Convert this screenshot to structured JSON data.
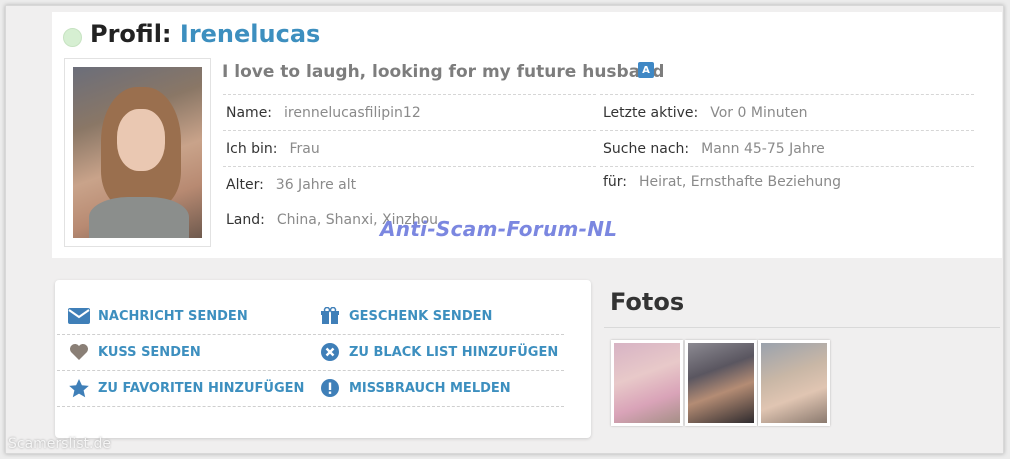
{
  "profile": {
    "title_prefix": "Profil:",
    "username": "Irenelucas",
    "tagline": "I love to laugh, looking for my future husband",
    "left_fields": [
      {
        "label": "Name:",
        "value": "irennelucasfilipin12"
      },
      {
        "label": "Ich bin:",
        "value": "Frau"
      },
      {
        "label": "Alter:",
        "value": "36 Jahre alt"
      },
      {
        "label": "Land:",
        "value": "China, Shanxi, Xinzhou"
      }
    ],
    "right_fields": [
      {
        "label": "Letzte aktive:",
        "value": "Vor 0 Minuten"
      },
      {
        "label": "Suche nach:",
        "value": "Mann 45-75 Jahre"
      },
      {
        "label": "für:",
        "value": "Heirat, Ernsthafte Beziehung"
      }
    ]
  },
  "actions": {
    "send_message": "NACHRICHT SENDEN",
    "send_gift": "GESCHENK SENDEN",
    "send_kiss": "KUSS SENDEN",
    "add_blacklist": "ZU BLACK LIST HINZUFÜGEN",
    "add_favorites": "ZU FAVORITEN HINZUFÜGEN",
    "report_abuse": "MISSBRAUCH MELDEN"
  },
  "fotos": {
    "heading": "Fotos"
  },
  "watermarks": {
    "forum": "Anti-Scam-Forum-NL",
    "site": "Scamerslist.de"
  },
  "colors": {
    "accent": "#3d8fbf",
    "icon_blue": "#3f7fb8",
    "heart_gray": "#8a7f76"
  }
}
